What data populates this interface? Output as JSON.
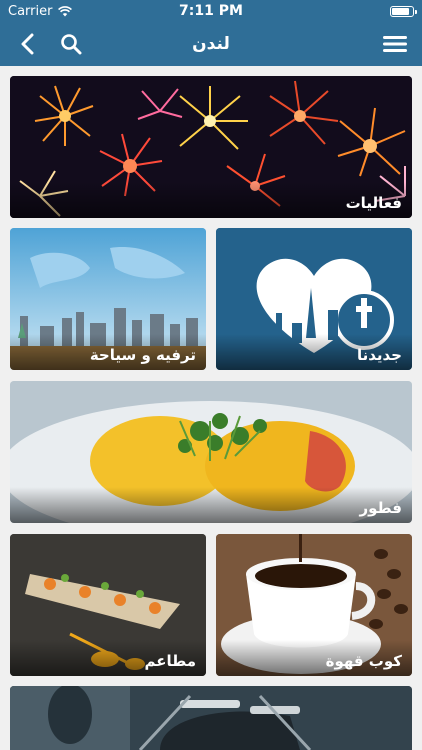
{
  "status": {
    "carrier": "Carrier",
    "time": "7:11 PM"
  },
  "nav": {
    "title": "لندن",
    "back_icon": "chevron-left-icon",
    "search_icon": "search-icon",
    "menu_icon": "hamburger-menu-icon"
  },
  "tiles": [
    {
      "id": "events",
      "label": "فعاليات"
    },
    {
      "id": "new",
      "label": "جديدنا"
    },
    {
      "id": "tourism",
      "label": "ترفيه و سياحة"
    },
    {
      "id": "breakfast",
      "label": "فطور"
    },
    {
      "id": "coffee",
      "label": "كوب قهوة"
    },
    {
      "id": "restaurants",
      "label": "مطاعم"
    },
    {
      "id": "more",
      "label": ""
    }
  ],
  "colors": {
    "accent": "#2f6e97",
    "background": "#f0f0f0"
  }
}
